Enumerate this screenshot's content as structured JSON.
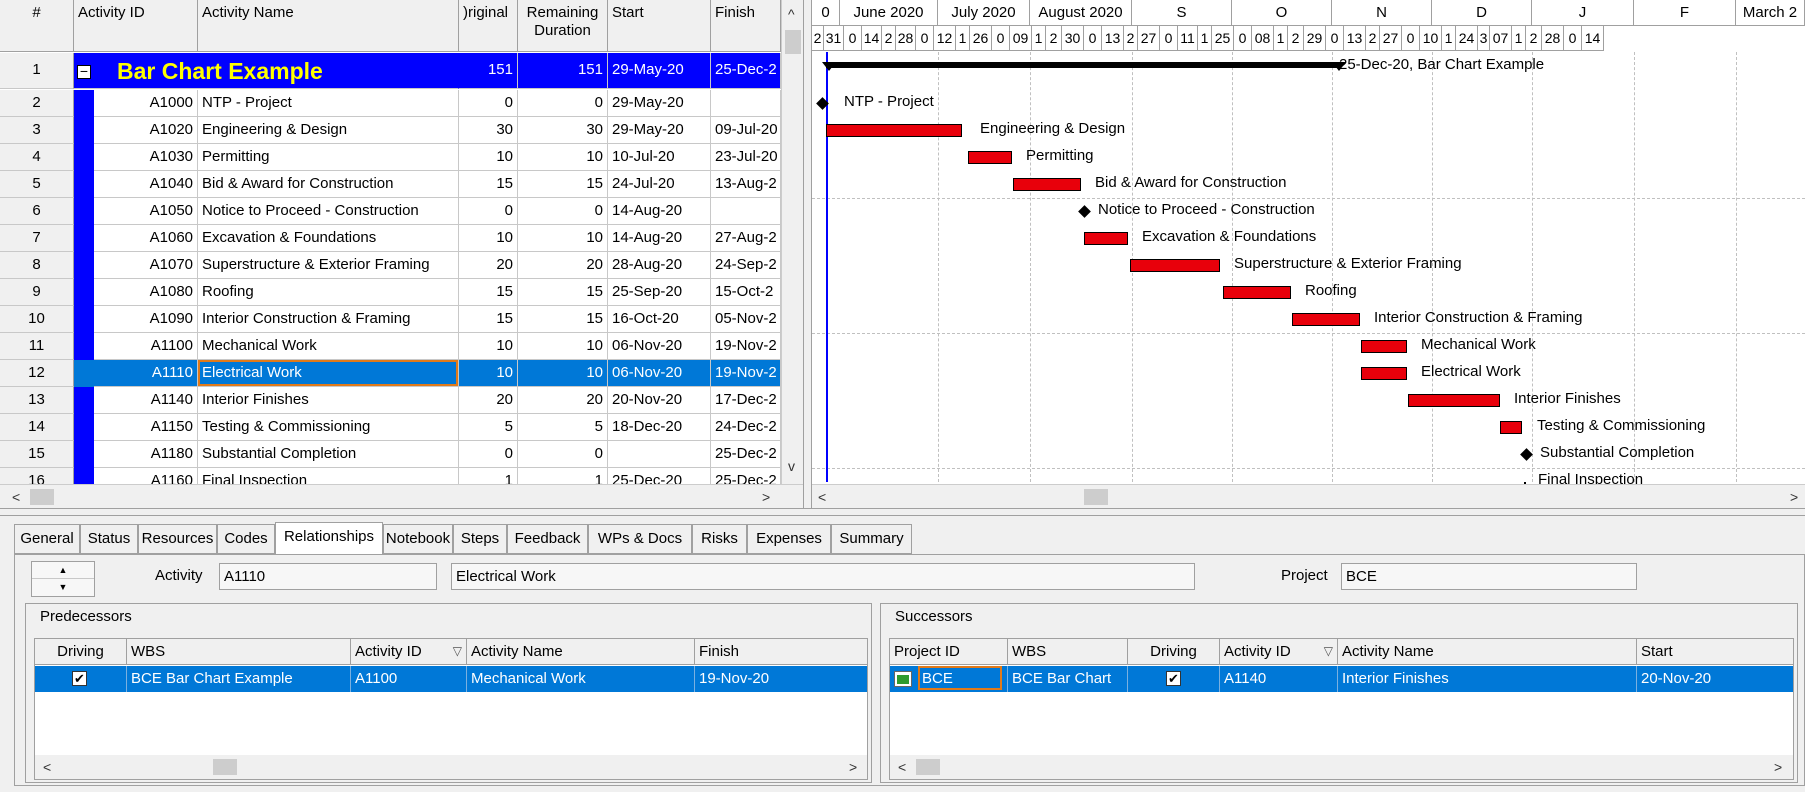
{
  "grid": {
    "headers": {
      "num": "#",
      "activity_id": "Activity ID",
      "activity_name": "Activity Name",
      "original": ")riginal",
      "remaining_1": "Remaining",
      "remaining_2": "Duration",
      "start": "Start",
      "finish": "Finish"
    },
    "summary_row": {
      "num": "1",
      "name": "Bar Chart Example",
      "original": "151",
      "remaining": "151",
      "start": "29-May-20",
      "finish": "25-Dec-2",
      "collapse_symbol": "−"
    },
    "rows": [
      {
        "num": "2",
        "id": "A1000",
        "name": "NTP - Project",
        "orig": "0",
        "rem": "0",
        "start": "29-May-20",
        "finish": ""
      },
      {
        "num": "3",
        "id": "A1020",
        "name": "Engineering & Design",
        "orig": "30",
        "rem": "30",
        "start": "29-May-20",
        "finish": "09-Jul-20"
      },
      {
        "num": "4",
        "id": "A1030",
        "name": "Permitting",
        "orig": "10",
        "rem": "10",
        "start": "10-Jul-20",
        "finish": "23-Jul-20"
      },
      {
        "num": "5",
        "id": "A1040",
        "name": "Bid & Award for Construction",
        "orig": "15",
        "rem": "15",
        "start": "24-Jul-20",
        "finish": "13-Aug-2"
      },
      {
        "num": "6",
        "id": "A1050",
        "name": "Notice to Proceed - Construction",
        "orig": "0",
        "rem": "0",
        "start": "14-Aug-20",
        "finish": ""
      },
      {
        "num": "7",
        "id": "A1060",
        "name": "Excavation & Foundations",
        "orig": "10",
        "rem": "10",
        "start": "14-Aug-20",
        "finish": "27-Aug-2"
      },
      {
        "num": "8",
        "id": "A1070",
        "name": "Superstructure & Exterior Framing",
        "orig": "20",
        "rem": "20",
        "start": "28-Aug-20",
        "finish": "24-Sep-2"
      },
      {
        "num": "9",
        "id": "A1080",
        "name": "Roofing",
        "orig": "15",
        "rem": "15",
        "start": "25-Sep-20",
        "finish": "15-Oct-2"
      },
      {
        "num": "10",
        "id": "A1090",
        "name": "Interior Construction & Framing",
        "orig": "15",
        "rem": "15",
        "start": "16-Oct-20",
        "finish": "05-Nov-2"
      },
      {
        "num": "11",
        "id": "A1100",
        "name": "Mechanical Work",
        "orig": "10",
        "rem": "10",
        "start": "06-Nov-20",
        "finish": "19-Nov-2"
      },
      {
        "num": "12",
        "id": "A1110",
        "name": "Electrical Work",
        "orig": "10",
        "rem": "10",
        "start": "06-Nov-20",
        "finish": "19-Nov-2"
      },
      {
        "num": "13",
        "id": "A1140",
        "name": "Interior Finishes",
        "orig": "20",
        "rem": "20",
        "start": "20-Nov-20",
        "finish": "17-Dec-2"
      },
      {
        "num": "14",
        "id": "A1150",
        "name": "Testing & Commissioning",
        "orig": "5",
        "rem": "5",
        "start": "18-Dec-20",
        "finish": "24-Dec-2"
      },
      {
        "num": "15",
        "id": "A1180",
        "name": "Substantial Completion",
        "orig": "0",
        "rem": "0",
        "start": "",
        "finish": "25-Dec-2"
      },
      {
        "num": "16",
        "id": "A1160",
        "name": "Final Inspection",
        "orig": "1",
        "rem": "1",
        "start": "25-Dec-20",
        "finish": "25-Dec-2"
      }
    ],
    "selected_row": "12"
  },
  "gantt": {
    "top_scale": [
      "0",
      "June 2020",
      "July 2020",
      "August 2020",
      "S",
      "O",
      "N",
      "D",
      "J",
      "F",
      "March 2"
    ],
    "day_scale": [
      "2",
      "31",
      "0",
      "14",
      "2",
      "28",
      "0",
      "12",
      "1",
      "26",
      "0",
      "09",
      "1",
      "2",
      "30",
      "0",
      "13",
      "2",
      "27",
      "0",
      "11",
      "1",
      "25",
      "0",
      "08",
      "1",
      "2",
      "29",
      "0",
      "13",
      "2",
      "27",
      "0",
      "10",
      "1",
      "24",
      "3",
      "07",
      "1",
      "2",
      "28",
      "0",
      "14"
    ],
    "summary_label": "25-Dec-20, Bar Chart Example",
    "labels": [
      "NTP - Project",
      "Engineering & Design",
      "Permitting",
      "Bid & Award for Construction",
      "Notice to Proceed - Construction",
      "Excavation & Foundations",
      "Superstructure & Exterior Framing",
      "Roofing",
      "Interior Construction & Framing",
      "Mechanical Work",
      "Electrical Work",
      "Interior Finishes",
      "Testing & Commissioning",
      "Substantial Completion",
      "Final Inspection"
    ],
    "bar_color": "#e8000b"
  },
  "tabs": [
    "General",
    "Status",
    "Resources",
    "Codes",
    "Relationships",
    "Notebook",
    "Steps",
    "Feedback",
    "WPs & Docs",
    "Risks",
    "Expenses",
    "Summary"
  ],
  "active_tab": "Relationships",
  "detail": {
    "activity_label": "Activity",
    "activity_id": "A1110",
    "activity_name": "Electrical Work",
    "project_label": "Project",
    "project_value": "BCE"
  },
  "predecessors": {
    "title": "Predecessors",
    "headers": [
      "Driving",
      "WBS",
      "Activity ID",
      "Activity Name",
      "Finish"
    ],
    "row": {
      "driving": "✔",
      "wbs": "BCE Bar Chart Example",
      "id": "A1100",
      "name": "Mechanical Work",
      "finish": "19-Nov-20"
    }
  },
  "successors": {
    "title": "Successors",
    "headers": [
      "Project ID",
      "WBS",
      "Driving",
      "Activity ID",
      "Activity Name",
      "Start"
    ],
    "row": {
      "project": "BCE",
      "wbs": "BCE Bar Chart",
      "driving": "✔",
      "id": "A1140",
      "name": "Interior Finishes",
      "start": "20-Nov-20"
    }
  },
  "icons": {
    "scroll_up": "^",
    "scroll_down": "v",
    "scroll_left": "<",
    "scroll_right": ">",
    "sort": "▽",
    "spin_up": "▲",
    "spin_down": "▼"
  },
  "colors": {
    "selection": "#0078d7",
    "summary_bg": "#0000ff",
    "summary_text": "#ffff00"
  }
}
